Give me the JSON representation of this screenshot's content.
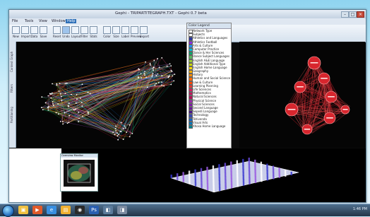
{
  "window": {
    "title": "Gephi - TRIPARTITEGRAPH.TXT - Gephi 0.7 beta"
  },
  "menubar": {
    "items": [
      "File",
      "Tools",
      "View",
      "Window",
      "Help"
    ],
    "active_index": 4
  },
  "ribbon": {
    "buttons": [
      {
        "label": "New"
      },
      {
        "label": "Import"
      },
      {
        "label": "Data"
      },
      {
        "label": "Save"
      },
      {
        "label": "Reset"
      },
      {
        "label": "Undo"
      },
      {
        "label": "Layout"
      },
      {
        "label": "Filter"
      },
      {
        "label": "Stats"
      },
      {
        "label": "Color"
      },
      {
        "label": "Size"
      },
      {
        "label": "Label"
      },
      {
        "label": "Preview"
      },
      {
        "label": "Export"
      }
    ]
  },
  "sidebar": {
    "tabs": [
      "Context Graph",
      "Filters",
      "Partitioning"
    ]
  },
  "legend": {
    "title": "Color Legend",
    "items": [
      {
        "label": "Network Type",
        "color": "#ffffff"
      },
      {
        "label": "Subjects",
        "color": "#ffffff"
      },
      {
        "label": "Athletics and Languages",
        "color": "#2e3b9e"
      },
      {
        "label": "Athletics Football",
        "color": "#8a2be2"
      },
      {
        "label": "Arts & Culture",
        "color": "#1e90ff"
      },
      {
        "label": "Computer Practice",
        "color": "#00bcd4"
      },
      {
        "label": "Dance & Her Sciences",
        "color": "#00a86b"
      },
      {
        "label": "Dance Subject Languages",
        "color": "#5cb85c"
      },
      {
        "label": "English A&E Language",
        "color": "#9acd32"
      },
      {
        "label": "English Additional Type",
        "color": "#c8d400"
      },
      {
        "label": "English Home Language",
        "color": "#ffd700"
      },
      {
        "label": "Geography",
        "color": "#ffb000"
      },
      {
        "label": "History",
        "color": "#ff8c00"
      },
      {
        "label": "Human and Social Science",
        "color": "#ff6a00"
      },
      {
        "label": "Law & Culture",
        "color": "#ff4500"
      },
      {
        "label": "Learning Planning",
        "color": "#e53935"
      },
      {
        "label": "Life Sciences",
        "color": "#d81b60"
      },
      {
        "label": "Mathematics",
        "color": "#c2185b"
      },
      {
        "label": "Natural Sciences",
        "color": "#ad1457"
      },
      {
        "label": "Physical Science",
        "color": "#9c27b0"
      },
      {
        "label": "Social Sciences",
        "color": "#7b1fa2"
      },
      {
        "label": "Second Language",
        "color": "#6a1b9a"
      },
      {
        "label": "Sepedi Language",
        "color": "#4a148c"
      },
      {
        "label": "Technology",
        "color": "#3949ab"
      },
      {
        "label": "Tshivenda",
        "color": "#1565c0"
      },
      {
        "label": "Visual Arts",
        "color": "#0277bd"
      },
      {
        "label": "Xhosa Home Language",
        "color": "#00838f"
      }
    ]
  },
  "overview": {
    "title": "Overview Monitor"
  },
  "taskbar": {
    "icons": [
      "explorer-icon",
      "media-player-icon",
      "internet-explorer-icon",
      "folder-icon",
      "gephi-icon",
      "photoshop-icon",
      "app-icon",
      "app-icon"
    ],
    "clock": "1:46 PM"
  }
}
